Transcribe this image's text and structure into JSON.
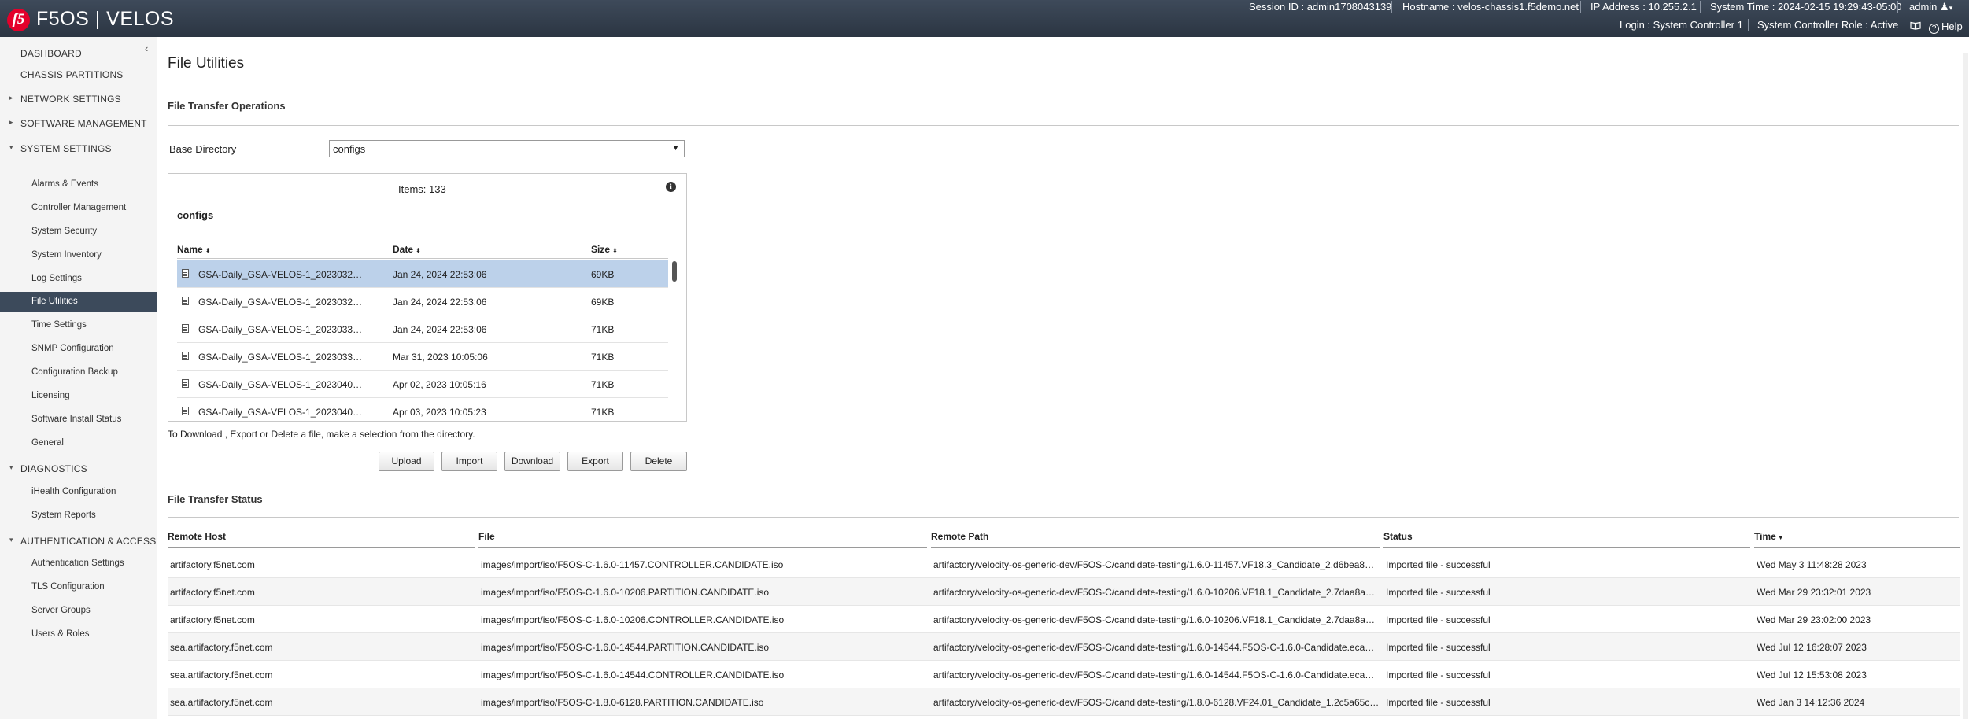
{
  "header": {
    "logo_text": "f5",
    "product": "F5OS | VELOS",
    "session": "Session ID : admin1708043139",
    "hostname": "Hostname : velos-chassis1.f5demo.net",
    "ip": "IP Address : 10.255.2.1",
    "time": "System Time : 2024-02-15 19:29:43-05:00",
    "user": "admin",
    "login": "Login : System Controller 1",
    "role": "System Controller Role : Active",
    "help": "Help"
  },
  "sidebar": {
    "items": [
      {
        "label": "DASHBOARD",
        "level": "top"
      },
      {
        "label": "CHASSIS PARTITIONS",
        "level": "top"
      },
      {
        "label": "NETWORK SETTINGS",
        "level": "top",
        "arrow": "▸"
      },
      {
        "label": "SOFTWARE MANAGEMENT",
        "level": "top",
        "arrow": "▸"
      },
      {
        "label": "SYSTEM SETTINGS",
        "level": "top",
        "arrow": "▾"
      },
      {
        "label": "Alarms & Events",
        "level": "sub"
      },
      {
        "label": "Controller Management",
        "level": "sub"
      },
      {
        "label": "System Security",
        "level": "sub"
      },
      {
        "label": "System Inventory",
        "level": "sub"
      },
      {
        "label": "Log Settings",
        "level": "sub"
      },
      {
        "label": "File Utilities",
        "level": "sub",
        "active": true
      },
      {
        "label": "Time Settings",
        "level": "sub"
      },
      {
        "label": "SNMP Configuration",
        "level": "sub"
      },
      {
        "label": "Configuration Backup",
        "level": "sub"
      },
      {
        "label": "Licensing",
        "level": "sub"
      },
      {
        "label": "Software Install Status",
        "level": "sub"
      },
      {
        "label": "General",
        "level": "sub"
      },
      {
        "label": "DIAGNOSTICS",
        "level": "top",
        "arrow": "▾"
      },
      {
        "label": "iHealth Configuration",
        "level": "sub"
      },
      {
        "label": "System Reports",
        "level": "sub"
      },
      {
        "label": "AUTHENTICATION & ACCESS",
        "level": "top",
        "arrow": "▾"
      },
      {
        "label": "Authentication Settings",
        "level": "sub"
      },
      {
        "label": "TLS Configuration",
        "level": "sub"
      },
      {
        "label": "Server Groups",
        "level": "sub"
      },
      {
        "label": "Users & Roles",
        "level": "sub"
      }
    ]
  },
  "page": {
    "title": "File Utilities",
    "transfer_ops_title": "File Transfer Operations",
    "base_dir_label": "Base Directory",
    "base_dir_value": "configs",
    "items_count": "Items: 133",
    "dir_name": "configs",
    "file_columns": [
      "Name",
      "Date",
      "Size"
    ],
    "files": [
      {
        "name": "GSA-Daily_GSA-VELOS-1_2023032…",
        "date": "Jan 24, 2024 22:53:06",
        "size": "69KB"
      },
      {
        "name": "GSA-Daily_GSA-VELOS-1_2023032…",
        "date": "Jan 24, 2024 22:53:06",
        "size": "69KB"
      },
      {
        "name": "GSA-Daily_GSA-VELOS-1_2023033…",
        "date": "Jan 24, 2024 22:53:06",
        "size": "71KB"
      },
      {
        "name": "GSA-Daily_GSA-VELOS-1_2023033…",
        "date": "Mar 31, 2023 10:05:06",
        "size": "71KB"
      },
      {
        "name": "GSA-Daily_GSA-VELOS-1_2023040…",
        "date": "Apr 02, 2023 10:05:16",
        "size": "71KB"
      },
      {
        "name": "GSA-Daily_GSA-VELOS-1_2023040…",
        "date": "Apr 03, 2023 10:05:23",
        "size": "71KB"
      }
    ],
    "hint": "To Download , Export or Delete a file, make a selection from the directory.",
    "buttons": [
      "Upload",
      "Import",
      "Download",
      "Export",
      "Delete"
    ],
    "status_title": "File Transfer Status",
    "status_columns": [
      "Remote Host",
      "File",
      "Remote Path",
      "Status",
      "Time"
    ],
    "status_rows": [
      [
        "artifactory.f5net.com",
        "images/import/iso/F5OS-C-1.6.0-11457.CONTROLLER.CANDIDATE.iso",
        "artifactory/velocity-os-generic-dev/F5OS-C/candidate-testing/1.6.0-11457.VF18.3_Candidate_2.d6bea8…",
        "Imported file - successful",
        "Wed May 3 11:48:28 2023"
      ],
      [
        "artifactory.f5net.com",
        "images/import/iso/F5OS-C-1.6.0-10206.PARTITION.CANDIDATE.iso",
        "artifactory/velocity-os-generic-dev/F5OS-C/candidate-testing/1.6.0-10206.VF18.1_Candidate_2.7daa8a…",
        "Imported file - successful",
        "Wed Mar 29 23:32:01 2023"
      ],
      [
        "artifactory.f5net.com",
        "images/import/iso/F5OS-C-1.6.0-10206.CONTROLLER.CANDIDATE.iso",
        "artifactory/velocity-os-generic-dev/F5OS-C/candidate-testing/1.6.0-10206.VF18.1_Candidate_2.7daa8a…",
        "Imported file - successful",
        "Wed Mar 29 23:02:00 2023"
      ],
      [
        "sea.artifactory.f5net.com",
        "images/import/iso/F5OS-C-1.6.0-14544.PARTITION.CANDIDATE.iso",
        "artifactory/velocity-os-generic-dev/F5OS-C/candidate-testing/1.6.0-14544.F5OS-C-1.6.0-Candidate.eca…",
        "Imported file - successful",
        "Wed Jul 12 16:28:07 2023"
      ],
      [
        "sea.artifactory.f5net.com",
        "images/import/iso/F5OS-C-1.6.0-14544.CONTROLLER.CANDIDATE.iso",
        "artifactory/velocity-os-generic-dev/F5OS-C/candidate-testing/1.6.0-14544.F5OS-C-1.6.0-Candidate.eca…",
        "Imported file - successful",
        "Wed Jul 12 15:53:08 2023"
      ],
      [
        "sea.artifactory.f5net.com",
        "images/import/iso/F5OS-C-1.8.0-6128.PARTITION.CANDIDATE.iso",
        "artifactory/velocity-os-generic-dev/F5OS-C/candidate-testing/1.8.0-6128.VF24.01_Candidate_1.2c5a65c…",
        "Imported file - successful",
        "Wed Jan 3 14:12:36 2024"
      ]
    ]
  }
}
